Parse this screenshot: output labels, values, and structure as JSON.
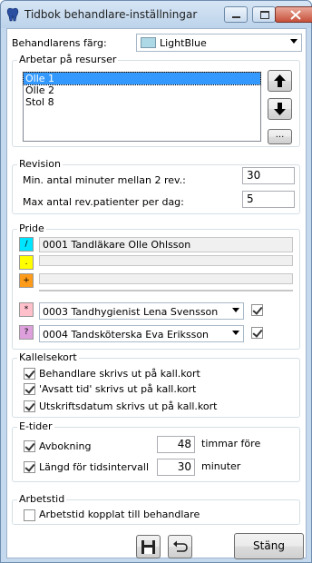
{
  "window": {
    "title": "Tidbok behandlare-inställningar"
  },
  "colour": {
    "label": "Behandlarens färg:",
    "value": "LightBlue",
    "swatch_color": "#add8e6"
  },
  "resources": {
    "title": "Arbetar på resurser",
    "items": [
      "Olle 1",
      "Olle 2",
      "Stol 8"
    ],
    "selected_index": 0,
    "more_label": "..."
  },
  "revision": {
    "title": "Revision",
    "min_label": "Min. antal minuter mellan 2 rev.:",
    "min_value": "30",
    "max_label": "Max antal rev.patienter per dag:",
    "max_value": "5"
  },
  "pride": {
    "title": "Pride",
    "rows": [
      {
        "symbol": "/",
        "color": "#00e5ff",
        "value": "0001 Tandläkare Olle Ohlsson"
      },
      {
        "symbol": ".",
        "color": "#ffff00",
        "value": ""
      },
      {
        "symbol": "+",
        "color": "#ff9b1a",
        "value": ""
      }
    ],
    "combos": [
      {
        "symbol": "*",
        "color": "#ffc0cb",
        "value": "0003 Tandhygienist Lena Svensson",
        "checked": true
      },
      {
        "symbol": "?",
        "color": "#dda0dd",
        "value": "0004 Tandsköterska Eva Eriksson",
        "checked": true
      }
    ]
  },
  "kallelsekort": {
    "title": "Kallelsekort",
    "options": [
      {
        "label": "Behandlare skrivs ut på kall.kort",
        "checked": true
      },
      {
        "label": "'Avsatt tid' skrivs ut på kall.kort",
        "checked": true
      },
      {
        "label": "Utskriftsdatum skrivs ut på kall.kort",
        "checked": true
      }
    ]
  },
  "etider": {
    "title": "E-tider",
    "avbokning_label": "Avbokning",
    "avbokning_value": "48",
    "avbokning_unit": "timmar före",
    "interval_label": "Längd för tidsintervall",
    "interval_value": "30",
    "interval_unit": "minuter",
    "avbokning_checked": true,
    "interval_checked": true
  },
  "arbetstid": {
    "title": "Arbetstid",
    "option_label": "Arbetstid kopplat till behandlare",
    "checked": false
  },
  "footer": {
    "close_label": "Stäng"
  }
}
